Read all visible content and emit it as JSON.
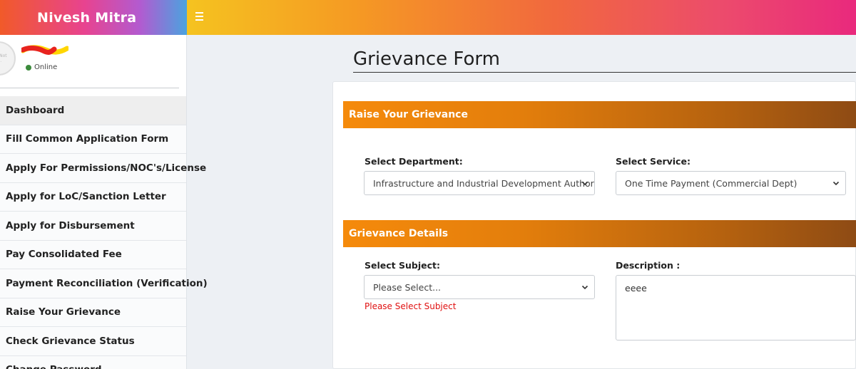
{
  "brand": {
    "title": "Nivesh Mitra"
  },
  "user": {
    "status": "Online",
    "avatar_text": "Image\nNot\nAvailable"
  },
  "sidebar": {
    "items": [
      {
        "label": "Dashboard"
      },
      {
        "label": "Fill Common Application Form"
      },
      {
        "label": "Apply For Permissions/NOC's/License"
      },
      {
        "label": "Apply for LoC/Sanction Letter"
      },
      {
        "label": "Apply for Disbursement"
      },
      {
        "label": "Pay Consolidated Fee"
      },
      {
        "label": "Payment Reconciliation (Verification)"
      },
      {
        "label": "Raise Your Grievance"
      },
      {
        "label": "Check Grievance Status"
      },
      {
        "label": "Change Password"
      }
    ]
  },
  "page": {
    "title": "Grievance Form"
  },
  "raise_section": {
    "title": "Raise Your Grievance",
    "department_label": "Select Department:",
    "department_value": "Infrastructure and Industrial Development Authority",
    "service_label": "Select Service:",
    "service_value": "One Time Payment (Commercial Dept)"
  },
  "details_section": {
    "title": "Grievance Details",
    "subject_label": "Select Subject:",
    "subject_value": "Please Select...",
    "subject_error": "Please Select Subject",
    "description_label": "Description :",
    "description_value": "eeee"
  },
  "colors": {
    "section_bar_start": "#f58a0b",
    "section_bar_end": "#8e4b14",
    "error": "#e01010",
    "online": "#3c8b3c"
  }
}
